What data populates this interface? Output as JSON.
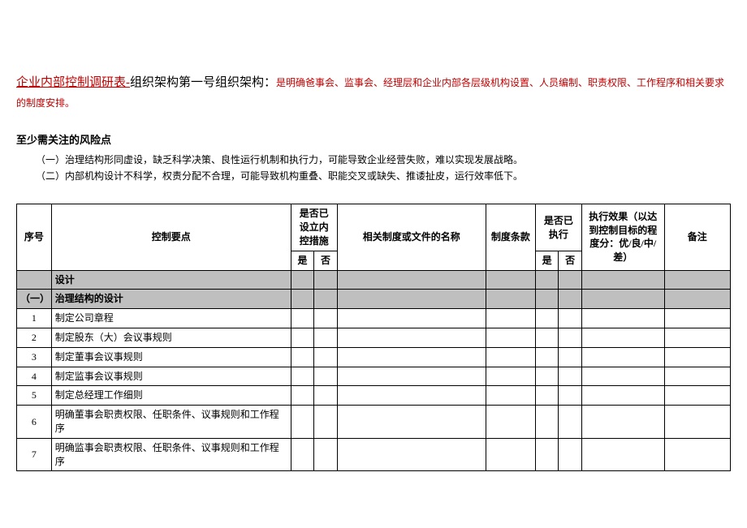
{
  "header": {
    "titleRed": "企业内部控制调研表-",
    "titleBlack": "组织架构第一号组织架构：",
    "introRed": "是明确爸事会、监事会、经理层和企业内部各层级机构设置、人员编制、职责权限、工作程序和相关要求的制度安排。"
  },
  "riskSection": {
    "title": "至少需关注的风险点",
    "points": [
      "（一）治理结构形同虚设，缺乏科学决策、良性运行机制和执行力，可能导致企业经营失败，难以实现发展战略。",
      "（二）内部机构设计不科学，权责分配不合理，可能导致机构重叠、职能交叉或缺失、推诿扯皮，运行效率低下。"
    ]
  },
  "table": {
    "headers": {
      "no": "序号",
      "control": "控制要点",
      "establishedGroup": "是否已设立内控措施",
      "yes": "是",
      "no2": "否",
      "docName": "相关制度或文件的名称",
      "clause": "制度条款",
      "executedGroup": "是否已执行",
      "effect": "执行效果（以达到控制目标的程度分：优/良/中/差）",
      "remark": "备注"
    },
    "rows": [
      {
        "type": "section",
        "no": "",
        "control": "设计"
      },
      {
        "type": "section",
        "no": "（一）",
        "control": "治理结构的设计"
      },
      {
        "type": "item",
        "no": "1",
        "control": "制定公司章程"
      },
      {
        "type": "item",
        "no": "2",
        "control": "制定股东（大）会议事规则"
      },
      {
        "type": "item",
        "no": "3",
        "control": "制定董事会议事规则"
      },
      {
        "type": "item",
        "no": "4",
        "control": "制定监事会议事规则"
      },
      {
        "type": "item",
        "no": "5",
        "control": "制定总经理工作细则"
      },
      {
        "type": "item-tall",
        "no": "6",
        "control": "明确董事会职责权限、任职条件、议事规则和工作程序"
      },
      {
        "type": "item-tall",
        "no": "7",
        "control": "明确监事会职责权限、任职条件、议事规则和工作程序"
      }
    ]
  }
}
